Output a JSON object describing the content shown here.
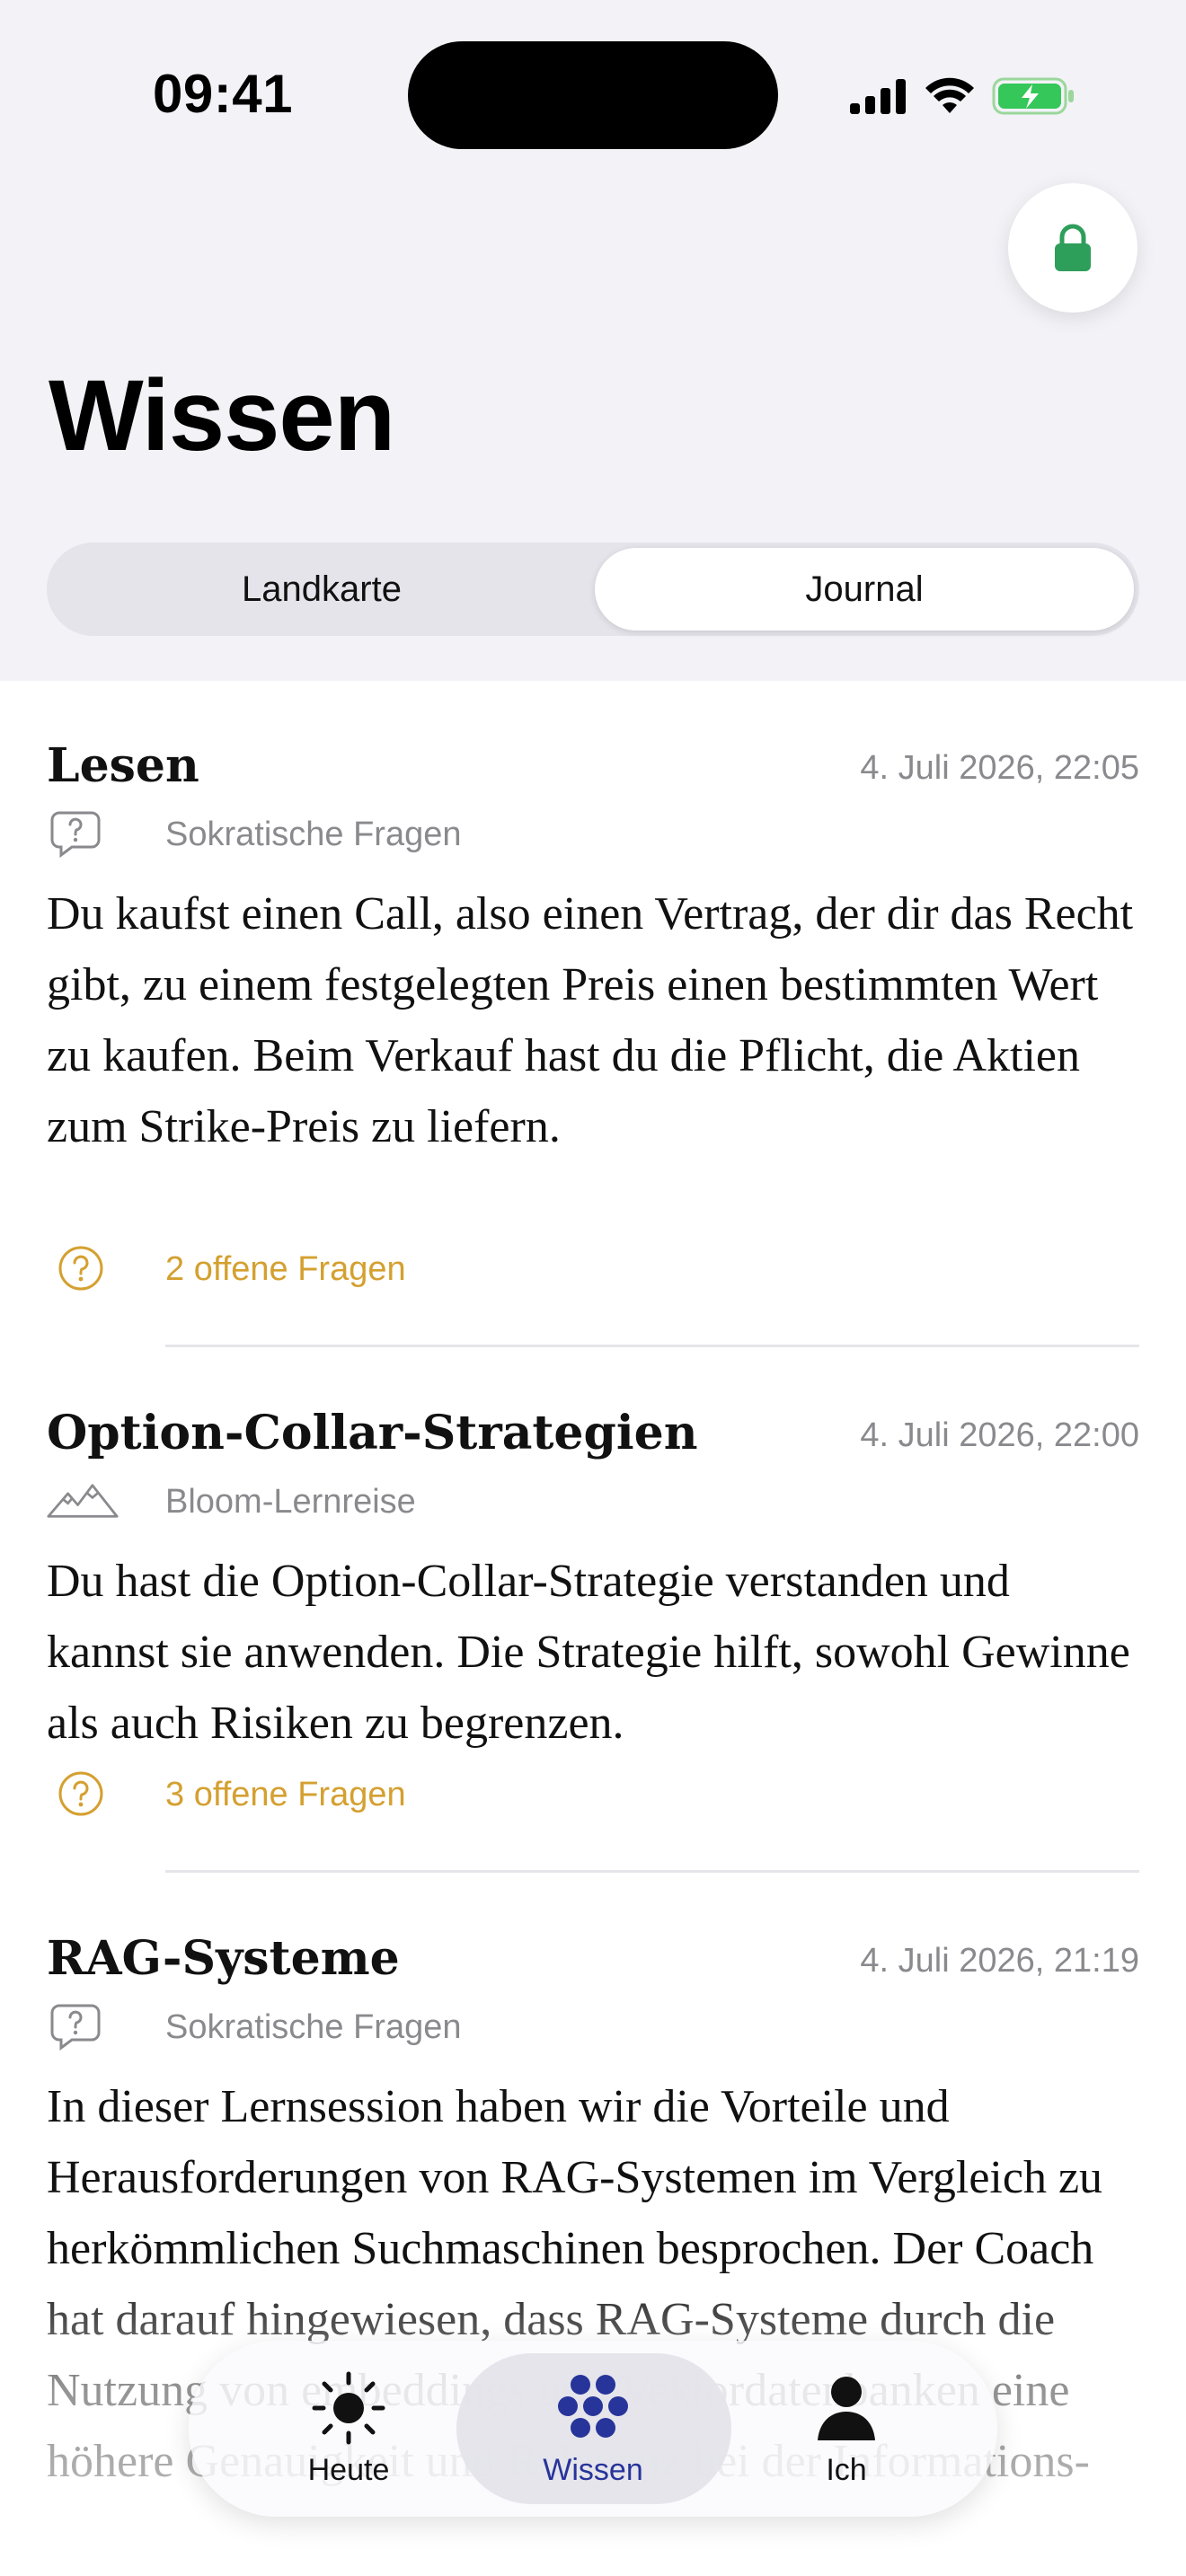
{
  "status_bar": {
    "time": "09:41"
  },
  "header": {
    "title": "Wissen",
    "segments": {
      "left": "Landkarte",
      "right": "Journal",
      "selected": "Journal"
    }
  },
  "entries": [
    {
      "title": "Lesen",
      "date": "4. Juli 2026, 22:05",
      "type_icon": "question-bubble-icon",
      "type_label": "Sokratische Fragen",
      "body": "Du kaufst einen Call, also einen Vertrag, der dir das Recht gibt, zu einem festgelegten Preis einen bestimmten Wert zu kaufen. Beim Verkauf hast du die Pflicht, die Aktien zum Strike-Preis zu liefern.",
      "questions": "2 offene Fragen"
    },
    {
      "title": "Option-Collar-Strategien",
      "date": "4. Juli 2026, 22:00",
      "type_icon": "mountains-icon",
      "type_label": "Bloom-Lernreise",
      "body": "Du hast die Option-Collar-Strategie verstanden und kannst sie anwenden. Die Strategie hilft, sowohl Gewinne als auch Risiken zu begrenzen.",
      "questions": "3 offene Fragen"
    },
    {
      "title": "RAG-Systeme",
      "date": "4. Juli 2026, 21:19",
      "type_icon": "question-bubble-icon",
      "type_label": "Sokratische Fragen",
      "body": "In dieser Lernsession haben wir die Vorteile und Herausforderungen von RAG-Systemen im Vergleich zu herkömmlichen Suchmaschinen besprochen. Der Coach hat darauf hingewiesen, dass RAG-Systeme durch die Nutzung von embeddings und Vektordatenbanken eine höhere Genauigkeit und Relevanz bei der Informations-"
    }
  ],
  "tabbar": {
    "tabs": [
      {
        "label": "Heute",
        "icon": "sun-icon"
      },
      {
        "label": "Wissen",
        "icon": "grape-cluster-icon",
        "active": true
      },
      {
        "label": "Ich",
        "icon": "person-icon"
      }
    ]
  },
  "colors": {
    "accent_green": "#2e9e5b",
    "accent_navy": "#27349a",
    "question_amber": "#d4a030"
  }
}
